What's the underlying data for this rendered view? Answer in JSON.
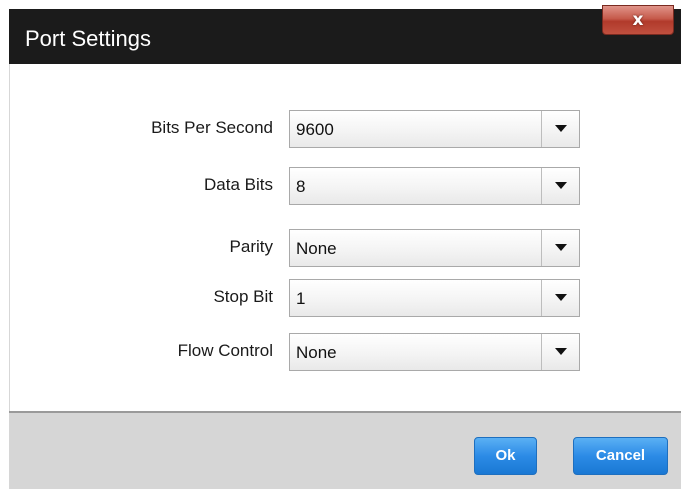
{
  "window": {
    "title": "Port Settings",
    "close_glyph": "x"
  },
  "fields": [
    {
      "label": "Bits Per Second",
      "value": "9600"
    },
    {
      "label": "Data Bits",
      "value": "8"
    },
    {
      "label": "Parity",
      "value": "None"
    },
    {
      "label": "Stop Bit",
      "value": "1"
    },
    {
      "label": "Flow Control",
      "value": "None"
    }
  ],
  "buttons": {
    "ok_label": "Ok",
    "cancel_label": "Cancel"
  },
  "colors": {
    "titlebar": "#1b1b1b",
    "close_button": "#c65a4b",
    "primary_button": "#2c8be6",
    "footer": "#d6d6d6"
  },
  "icons": {
    "close": "close-icon",
    "dropdown": "chevron-down-icon"
  }
}
